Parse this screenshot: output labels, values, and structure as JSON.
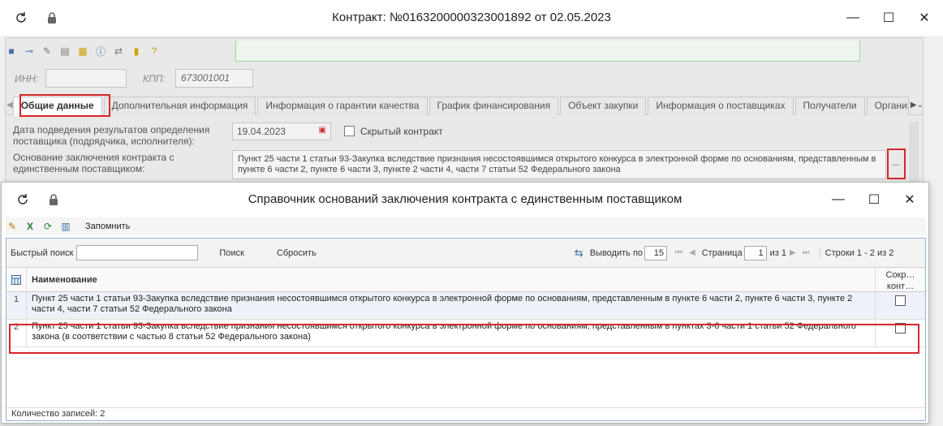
{
  "bg": {
    "title": "Контракт: №0163200000323001892 от 02.05.2023",
    "inn_label": "ИНН:",
    "inn_value": "",
    "kpp_label": "КПП:",
    "kpp_value": "673001001",
    "tabs": [
      "Общие данные",
      "Дополнительная информация",
      "Информация о гарантии качества",
      "График финансирования",
      "Объект закупки",
      "Информация о поставщиках",
      "Получатели",
      "Организация разм"
    ],
    "date_label": "Дата подведения результатов определения поставщика (подрядчика, исполнителя):",
    "date_value": "19.04.2023",
    "hidden_label": "Скрытый контракт",
    "basis_label": "Основание заключения контракта с единственным поставщиком:",
    "basis_value": "Пункт 25 части 1 статьи 93-Закупка вследствие признания несостоявшимся открытого конкурса в электронной форме по основаниям, представленным в пункте 6 части 2, пункте 6 части 3, пункте 2 части 4, части 7 статьи 52 Федерального закона",
    "ellipsis": "..."
  },
  "dialog": {
    "title": "Справочник оснований заключения контракта с единственным поставщиком",
    "toolbar_remember": "Запомнить",
    "search_label": "Быстрый поиск",
    "search_value": "",
    "search_btn": "Поиск",
    "reset_btn": "Сбросить",
    "show_by_label": "Выводить по",
    "page_size": "15",
    "page_label": "Страница",
    "page_num": "1",
    "page_of": "из 1",
    "rows_label": "Строки 1 - 2 из 2",
    "col_name": "Наименование",
    "col_check": "Сокр… конт…",
    "rows": [
      {
        "n": "1",
        "text": "Пункт 25 части 1 статьи 93-Закупка вследствие признания несостоявшимся открытого конкурса в электронной форме по основаниям, представленным в пункте 6 части 2, пункте 6 части 3, пункте 2 части 4, части 7 статьи 52 Федерального закона"
      },
      {
        "n": "2",
        "text": "Пункт 25 части 1 статьи 93-Закупка вследствие признания несостоявшимся открытого конкурса в электронной форме по основаниям, представленным в пунктах 3-6 части 1 статьи 52 Федерального закона (в соответствии с частью 8 статьи 52 Федерального закона)"
      }
    ],
    "footer": "Количество записей: 2"
  },
  "colors": {
    "highlight": "#d6272b",
    "accent": "#99b2cc"
  }
}
